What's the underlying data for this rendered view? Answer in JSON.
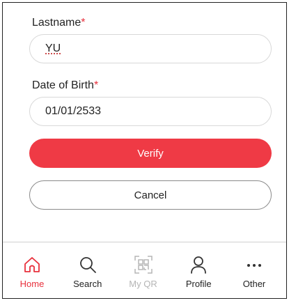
{
  "form": {
    "lastname_label": "Lastname",
    "lastname_value": "YU",
    "dob_label": "Date of Birth",
    "dob_value": "01/01/2533",
    "required_mark": "*"
  },
  "buttons": {
    "verify": "Verify",
    "cancel": "Cancel"
  },
  "nav": {
    "items": [
      {
        "label": "Home",
        "icon": "home-icon",
        "state": "active"
      },
      {
        "label": "Search",
        "icon": "search-icon",
        "state": "normal"
      },
      {
        "label": "My QR",
        "icon": "qr-code-icon",
        "state": "disabled"
      },
      {
        "label": "Profile",
        "icon": "profile-icon",
        "state": "normal"
      },
      {
        "label": "Other",
        "icon": "more-icon",
        "state": "normal"
      }
    ]
  },
  "colors": {
    "accent": "#ef3a45",
    "disabled": "#b5b5b5"
  }
}
